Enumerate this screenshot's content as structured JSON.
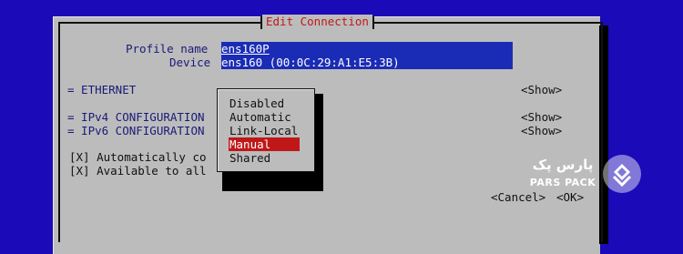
{
  "dialog": {
    "title": "Edit Connection",
    "profile_label": "Profile name",
    "profile_value": "ens160P",
    "device_label": "Device",
    "device_value": "ens160 (00:0C:29:A1:E5:3B)",
    "ethernet": "= ETHERNET",
    "ipv4": "= IPv4 CONFIGURATION",
    "ipv6": "= IPv6 CONFIGURATION",
    "show_label": "<Show>",
    "auto_connect": "[X] Automatically co",
    "available_all": "[X] Available to all",
    "cancel_label": "<Cancel>",
    "ok_label": "<OK>"
  },
  "popup": {
    "options": [
      "Disabled",
      "Automatic",
      "Link-Local",
      "Manual",
      "Shared"
    ],
    "selected": "Manual"
  },
  "watermark": {
    "text_fa": "پارس پک",
    "text_en": "PARS PACK"
  },
  "colors": {
    "background": "#1a0ab8",
    "dialog": "#bcbcbc",
    "title": "#c01818",
    "field": "#1a2cb6",
    "selected": "#c01818"
  }
}
